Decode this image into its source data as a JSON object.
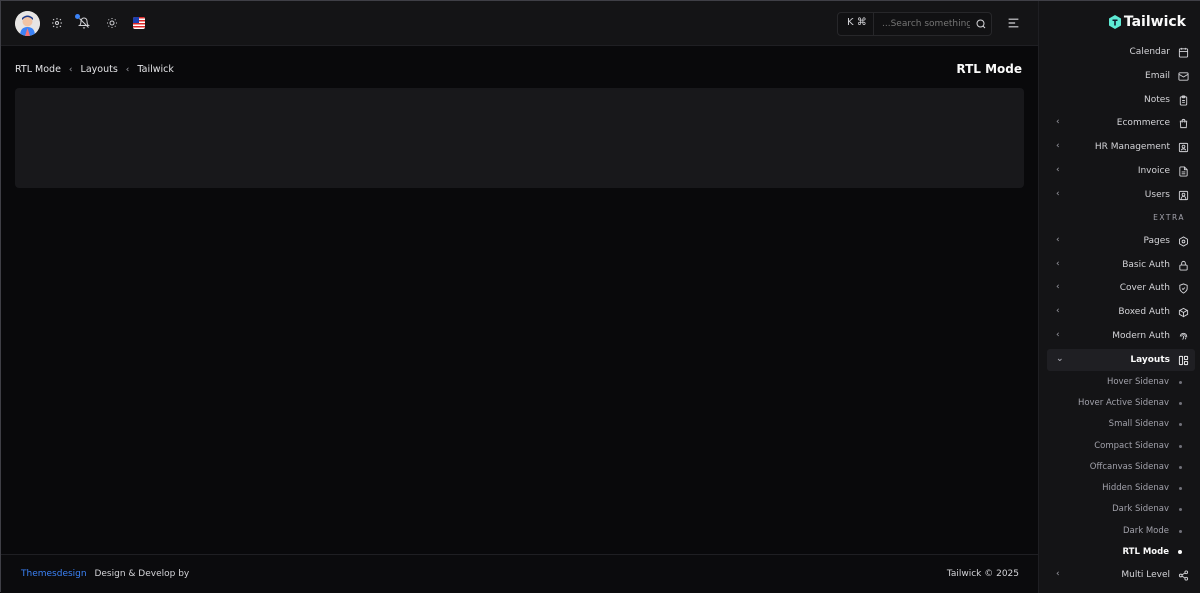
{
  "topbar": {
    "search": {
      "shortcut": "K ⌘",
      "placeholder": "...Search something"
    }
  },
  "breadcrumb": {
    "items": [
      "RTL Mode",
      "Layouts",
      "Tailwick"
    ]
  },
  "page": {
    "title": "RTL Mode"
  },
  "footer": {
    "brand": "Themesdesign",
    "text": "Design & Develop by",
    "copyright": "Tailwick © 2025"
  },
  "sidebar": {
    "logo": "Tailwick",
    "items": [
      {
        "label": "Calendar",
        "icon": "calendar-icon"
      },
      {
        "label": "Email",
        "icon": "mail-icon"
      },
      {
        "label": "Notes",
        "icon": "clipboard-icon"
      },
      {
        "label": "Ecommerce",
        "icon": "shopping-bag-icon"
      },
      {
        "label": "HR Management",
        "icon": "id-card-icon"
      },
      {
        "label": "Invoice",
        "icon": "file-text-icon"
      },
      {
        "label": "Users",
        "icon": "user-square-icon"
      }
    ],
    "section_extra": "EXTRA",
    "extra_items": [
      {
        "label": "Pages",
        "icon": "settings-icon"
      },
      {
        "label": "Basic Auth",
        "icon": "lock-icon"
      },
      {
        "label": "Cover Auth",
        "icon": "shield-check-icon"
      },
      {
        "label": "Boxed Auth",
        "icon": "box-icon"
      },
      {
        "label": "Modern Auth",
        "icon": "fingerprint-icon"
      },
      {
        "label": "Layouts",
        "icon": "layout-icon"
      }
    ],
    "layout_subitems": [
      "Hover Sidenav",
      "Hover Active Sidenav",
      "Small Sidenav",
      "Compact Sidenav",
      "Offcanvas Sidenav",
      "Hidden Sidenav",
      "Dark Sidenav",
      "Dark Mode",
      "RTL Mode"
    ],
    "multi_level": {
      "label": "Multi Level",
      "icon": "share-icon"
    }
  },
  "colors": {
    "accent": "#3b82f6",
    "background": "#09090b",
    "panel": "#141416",
    "card": "#18181b"
  }
}
